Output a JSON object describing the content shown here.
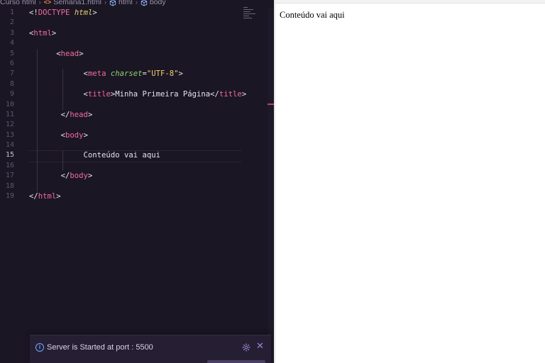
{
  "breadcrumb": {
    "items": [
      {
        "label": "Curso html",
        "icon": null
      },
      {
        "label": "Semana1.html",
        "icon": "html-file-icon"
      },
      {
        "label": "html",
        "icon": "cube-icon"
      },
      {
        "label": "body",
        "icon": "cube-icon"
      }
    ]
  },
  "editor": {
    "active_line": 15,
    "line_numbers": [
      "1",
      "2",
      "3",
      "4",
      "5",
      "6",
      "7",
      "8",
      "9",
      "10",
      "11",
      "12",
      "13",
      "14",
      "15",
      "16",
      "17",
      "18",
      "19"
    ],
    "lines": [
      {
        "indent": "",
        "tokens": [
          {
            "t": "<!",
            "c": "punc"
          },
          {
            "t": "DOCTYPE",
            "c": "doc"
          },
          {
            "t": " ",
            "c": "text"
          },
          {
            "t": "html",
            "c": "kw"
          },
          {
            "t": ">",
            "c": "punc"
          }
        ]
      },
      {
        "indent": "",
        "tokens": []
      },
      {
        "indent": "",
        "tokens": [
          {
            "t": "<",
            "c": "punc"
          },
          {
            "t": "html",
            "c": "tag"
          },
          {
            "t": ">",
            "c": "punc"
          }
        ]
      },
      {
        "indent": "",
        "tokens": []
      },
      {
        "indent": "      ",
        "tokens": [
          {
            "t": "<",
            "c": "punc"
          },
          {
            "t": "head",
            "c": "tag"
          },
          {
            "t": ">",
            "c": "punc"
          }
        ]
      },
      {
        "indent": "",
        "tokens": []
      },
      {
        "indent": "            ",
        "tokens": [
          {
            "t": "<",
            "c": "punc"
          },
          {
            "t": "meta",
            "c": "tag"
          },
          {
            "t": " ",
            "c": "text"
          },
          {
            "t": "charset",
            "c": "attr"
          },
          {
            "t": "=",
            "c": "punc"
          },
          {
            "t": "\"UTF-8\"",
            "c": "str"
          },
          {
            "t": ">",
            "c": "punc"
          }
        ]
      },
      {
        "indent": "",
        "tokens": []
      },
      {
        "indent": "            ",
        "tokens": [
          {
            "t": "<",
            "c": "punc"
          },
          {
            "t": "title",
            "c": "tag"
          },
          {
            "t": ">",
            "c": "punc"
          },
          {
            "t": "Minha Primeira Página",
            "c": "text"
          },
          {
            "t": "</",
            "c": "punc"
          },
          {
            "t": "title",
            "c": "tag"
          },
          {
            "t": ">",
            "c": "punc"
          }
        ]
      },
      {
        "indent": "",
        "tokens": []
      },
      {
        "indent": "       ",
        "tokens": [
          {
            "t": "</",
            "c": "punc"
          },
          {
            "t": "head",
            "c": "tag"
          },
          {
            "t": ">",
            "c": "punc"
          }
        ]
      },
      {
        "indent": "",
        "tokens": []
      },
      {
        "indent": "       ",
        "tokens": [
          {
            "t": "<",
            "c": "punc"
          },
          {
            "t": "body",
            "c": "tag"
          },
          {
            "t": ">",
            "c": "punc"
          }
        ]
      },
      {
        "indent": "",
        "tokens": []
      },
      {
        "indent": "            ",
        "tokens": [
          {
            "t": "Conteúdo vai aqui",
            "c": "text"
          }
        ]
      },
      {
        "indent": "",
        "tokens": []
      },
      {
        "indent": "       ",
        "tokens": [
          {
            "t": "</",
            "c": "punc"
          },
          {
            "t": "body",
            "c": "tag"
          },
          {
            "t": ">",
            "c": "punc"
          }
        ]
      },
      {
        "indent": "",
        "tokens": []
      },
      {
        "indent": "",
        "tokens": [
          {
            "t": "</",
            "c": "punc"
          },
          {
            "t": "html",
            "c": "tag"
          },
          {
            "t": ">",
            "c": "punc"
          }
        ]
      }
    ]
  },
  "notification": {
    "message": "Server is Started at port : 5500",
    "info_icon": "info-icon",
    "settings_icon": "gear-icon",
    "close_icon": "close-icon"
  },
  "browser": {
    "content": "Conteúdo vai aqui"
  },
  "colors": {
    "editor_bg": "#1b1624",
    "tag": "#f16b9b",
    "attribute": "#8fd16b",
    "string": "#f2d06b",
    "info": "#6fa8ff"
  }
}
